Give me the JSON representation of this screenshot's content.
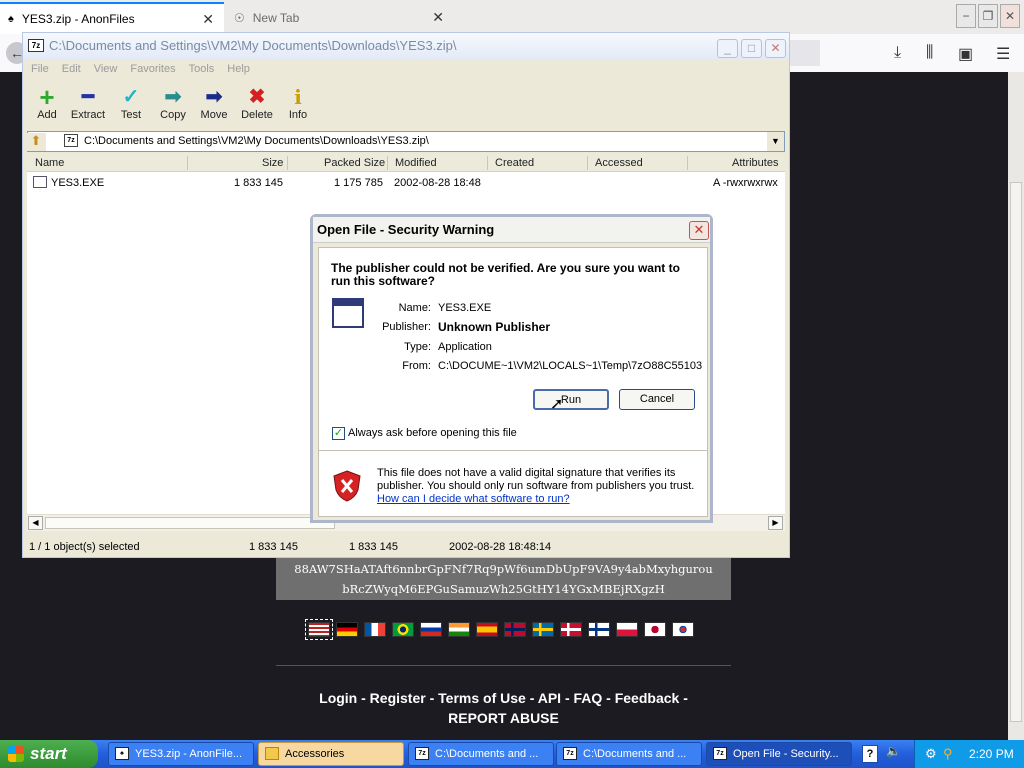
{
  "firefox": {
    "tabs": [
      {
        "label": "YES3.zip - AnonFiles",
        "close": "✕"
      },
      {
        "label": "New Tab",
        "close": "✕"
      }
    ],
    "window_buttons": [
      "−",
      "❐",
      "✕"
    ],
    "nav_icons": [
      "back-icon",
      "download-icon",
      "library-icon",
      "sidebar-icon",
      "menu-icon"
    ]
  },
  "page": {
    "url_lines": [
      "88AW7SHaATAft6nnbrGpFNf7Rq9pWf6umDbUpF9VA9y4abMxyhgurou",
      "bRcZWyqM6EPGuSamuzWh25GtHY14YGxMBEjRXgzH"
    ],
    "flags": [
      "us",
      "de",
      "fr",
      "br",
      "ru",
      "in",
      "es",
      "no",
      "se",
      "dk",
      "fi",
      "pl",
      "jp",
      "kr"
    ],
    "footer_line1": "Login - Register - Terms of Use - API - FAQ - Feedback -",
    "footer_line2": "REPORT ABUSE"
  },
  "sevenzip": {
    "title": "C:\\Documents and Settings\\VM2\\My Documents\\Downloads\\YES3.zip\\",
    "icon_label": "7z",
    "menu": [
      "File",
      "Edit",
      "View",
      "Favorites",
      "Tools",
      "Help"
    ],
    "toolbar": [
      {
        "label": "Add",
        "icon": "plus-icon",
        "glyph": "+",
        "color": "#2faa2f"
      },
      {
        "label": "Extract",
        "icon": "minus-icon",
        "glyph": "━",
        "color": "#2233aa"
      },
      {
        "label": "Test",
        "icon": "check-icon",
        "glyph": "✓",
        "color": "#22b5c8"
      },
      {
        "label": "Copy",
        "icon": "copy-arrow-icon",
        "glyph": "➡",
        "color": "#2a8c8c"
      },
      {
        "label": "Move",
        "icon": "move-arrow-icon",
        "glyph": "➡",
        "color": "#1c2c8a"
      },
      {
        "label": "Delete",
        "icon": "delete-icon",
        "glyph": "✖",
        "color": "#d42020"
      },
      {
        "label": "Info",
        "icon": "info-icon",
        "glyph": "i",
        "color": "#c9a000"
      }
    ],
    "address": "C:\\Documents and Settings\\VM2\\My Documents\\Downloads\\YES3.zip\\",
    "columns": [
      "Name",
      "Size",
      "Packed Size",
      "Modified",
      "Created",
      "Accessed",
      "Attributes"
    ],
    "rows": [
      {
        "name": "YES3.EXE",
        "size": "1 833 145",
        "packed": "1 175 785",
        "modified": "2002-08-28 18:48",
        "created": "",
        "accessed": "",
        "attributes": "A -rwxrwxrwx"
      }
    ],
    "status": [
      "1 / 1 object(s) selected",
      "1 833 145",
      "1 833 145",
      "2002-08-28 18:48:14"
    ]
  },
  "dialog": {
    "title": "Open File - Security Warning",
    "close": "✕",
    "question": "The publisher could not be verified.  Are you sure you want to run this software?",
    "fields": [
      {
        "label": "Name:",
        "value": "YES3.EXE"
      },
      {
        "label": "Publisher:",
        "value": "Unknown Publisher"
      },
      {
        "label": "Type:",
        "value": "Application"
      },
      {
        "label": "From:",
        "value": "C:\\DOCUME~1\\VM2\\LOCALS~1\\Temp\\7zO88C55103"
      }
    ],
    "run": "Run",
    "cancel": "Cancel",
    "checkbox_label": "Always ask before opening this file",
    "checkbox_checked": true,
    "warning": "This file does not have a valid digital signature that verifies its publisher.  You should only run software from publishers you trust.",
    "link": "How can I decide what software to run?"
  },
  "taskbar": {
    "start": "start",
    "tasks": [
      "YES3.zip - AnonFile...",
      "Accessories",
      "C:\\Documents and ...",
      "C:\\Documents and ...",
      "Open File - Security..."
    ],
    "time": "2:20 PM"
  }
}
